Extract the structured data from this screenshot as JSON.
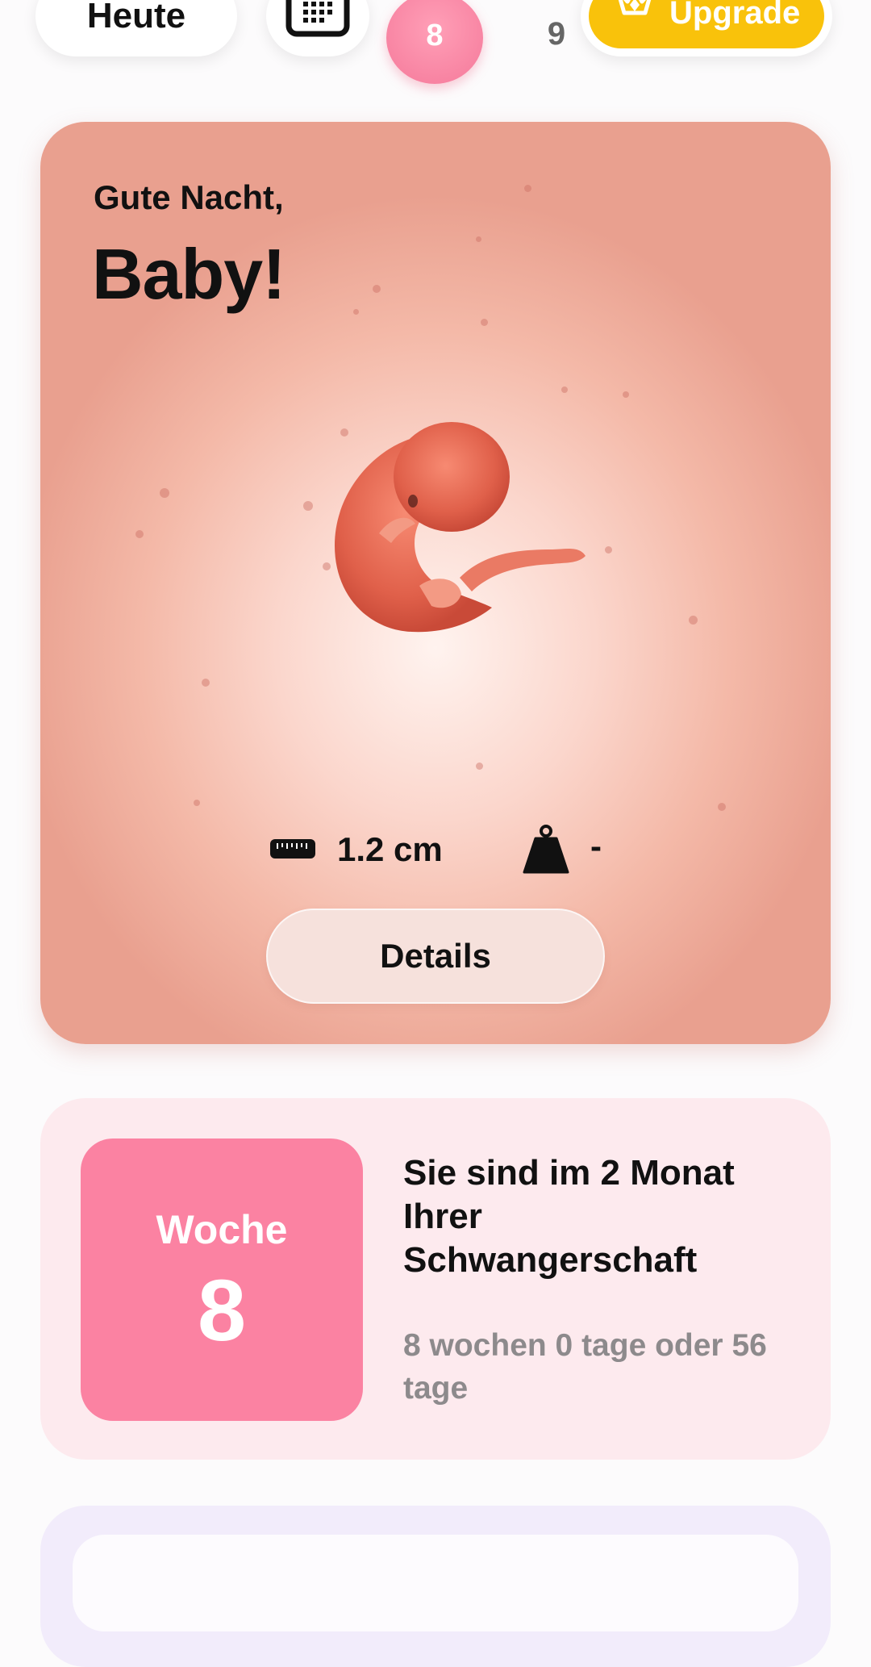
{
  "topbar": {
    "today_label": "Heute",
    "calendar_icon": "calendar-icon",
    "current_week": "8",
    "next_week": "9",
    "upgrade_label": "Upgrade",
    "upgrade_icon": "crown-icon",
    "accent_pink": "#f5799a",
    "upgrade_color": "#f9c20b"
  },
  "hero": {
    "greeting_small": "Gute Nacht,",
    "greeting_big": "Baby!",
    "length_icon": "ruler-icon",
    "length_value": "1.2 cm",
    "weight_icon": "weight-icon",
    "weight_value": "-",
    "details_label": "Details"
  },
  "week_card": {
    "tile_label": "Woche",
    "tile_number": "8",
    "headline": "Sie sind im 2 Monat Ihrer Schwangerschaft",
    "subtext": "8 wochen 0 tage oder 56 tage",
    "tile_color": "#fb82a2"
  }
}
